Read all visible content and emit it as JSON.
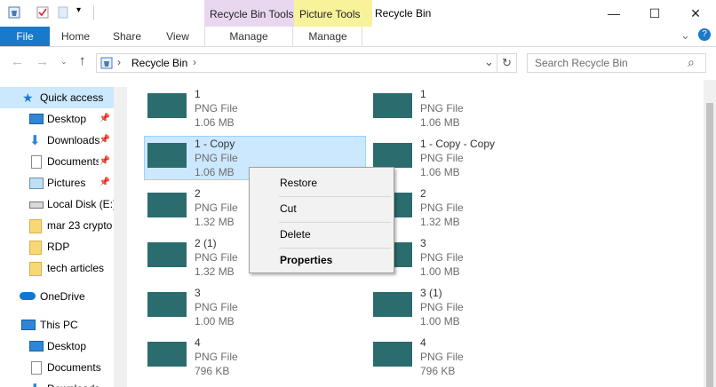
{
  "window": {
    "title": "Recycle Bin",
    "minimize": "—",
    "maximize": "☐",
    "close": "✕",
    "context_tabs": [
      "Recycle Bin Tools",
      "Picture Tools"
    ]
  },
  "ribbon": {
    "file": "File",
    "tabs": [
      "Home",
      "Share",
      "View"
    ],
    "context_manage": [
      "Manage",
      "Manage"
    ],
    "expand_glyph": "⌄",
    "help_glyph": "?"
  },
  "address": {
    "back": "←",
    "forward": "→",
    "up": "↑",
    "separator1": "›",
    "location": "Recycle Bin",
    "separator2": "›",
    "dropdown": "⌄",
    "refresh": "↻",
    "search_placeholder": "Search Recycle Bin",
    "search_icon": "⌕"
  },
  "nav": {
    "quick_access": "Quick access",
    "items": [
      {
        "label": "Desktop",
        "pinned": "📌"
      },
      {
        "label": "Downloads",
        "pinned": "📌"
      },
      {
        "label": "Documents",
        "pinned": "📌"
      },
      {
        "label": "Pictures",
        "pinned": "📌"
      },
      {
        "label": "Local Disk (E:)"
      },
      {
        "label": "mar 23 crypto"
      },
      {
        "label": "RDP"
      },
      {
        "label": "tech articles"
      }
    ],
    "onedrive": "OneDrive",
    "this_pc": "This PC",
    "pc_items": [
      {
        "label": "Desktop"
      },
      {
        "label": "Documents"
      },
      {
        "label": "Downloads"
      }
    ]
  },
  "files": [
    {
      "name": "1",
      "type": "PNG File",
      "size": "1.06 MB"
    },
    {
      "name": "1",
      "type": "PNG File",
      "size": "1.06 MB"
    },
    {
      "name": "1 - Copy",
      "type": "PNG File",
      "size": "1.06 MB",
      "selected": true
    },
    {
      "name": "1 - Copy - Copy",
      "type": "PNG File",
      "size": "1.06 MB"
    },
    {
      "name": "2",
      "type": "PNG File",
      "size": "1.32 MB"
    },
    {
      "name": "2",
      "type": "PNG File",
      "size": "1.32 MB"
    },
    {
      "name": "2 (1)",
      "type": "PNG File",
      "size": "1.32 MB"
    },
    {
      "name": "3",
      "type": "PNG File",
      "size": "1.00 MB"
    },
    {
      "name": "3",
      "type": "PNG File",
      "size": "1.00 MB"
    },
    {
      "name": "3 (1)",
      "type": "PNG File",
      "size": "1.00 MB"
    },
    {
      "name": "4",
      "type": "PNG File",
      "size": "796 KB"
    },
    {
      "name": "4",
      "type": "PNG File",
      "size": "796 KB"
    }
  ],
  "context_menu": {
    "items": [
      "Restore",
      "Cut",
      "Delete",
      "Properties"
    ]
  }
}
